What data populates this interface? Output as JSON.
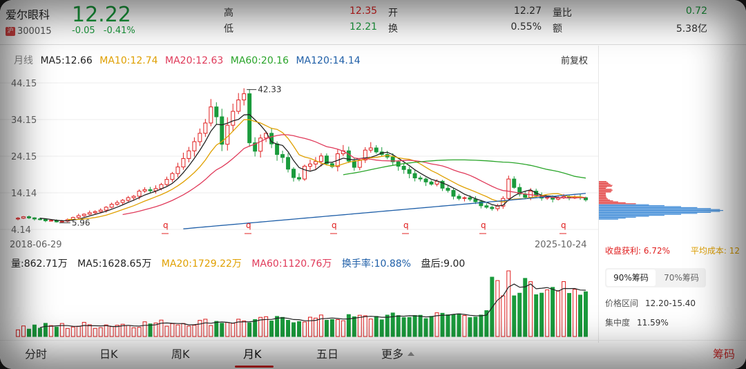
{
  "header": {
    "name": "爱尔眼科",
    "code": "300015",
    "price": "12.22",
    "change": "-0.05",
    "change_pct": "-0.41%",
    "stats": [
      {
        "key": "高",
        "value": "12.35",
        "color": "#e02020"
      },
      {
        "key": "低",
        "value": "12.21",
        "color": "#1a9b3c"
      },
      {
        "key": "开",
        "value": "12.27",
        "color": "#333333"
      },
      {
        "key": "换",
        "value": "0.55%",
        "color": "#333333"
      },
      {
        "key": "量比",
        "value": "0.72",
        "color": "#1a9b3c"
      },
      {
        "key": "额",
        "value": "5.38亿",
        "color": "#333333"
      }
    ]
  },
  "chart": {
    "period_label": "月线",
    "ma": [
      {
        "label": "MA5:12.66",
        "color": "#222222"
      },
      {
        "label": "MA10:12.74",
        "color": "#e0a000"
      },
      {
        "label": "MA20:12.63",
        "color": "#e03a5a"
      },
      {
        "label": "MA60:20.16",
        "color": "#2aa52a"
      },
      {
        "label": "MA120:14.14",
        "color": "#1f5fa8"
      }
    ],
    "adjust": "前复权",
    "y_ticks": [
      "44.15",
      "34.15",
      "24.15",
      "14.14",
      "4.14"
    ],
    "high_label": "42.33",
    "low_label": "5.96",
    "start_date": "2018-06-29",
    "end_date": "2025-10-24"
  },
  "volume": {
    "items": [
      {
        "label": "量:862.71万",
        "color": "#222222"
      },
      {
        "label": "MA5:1628.65万",
        "color": "#222222"
      },
      {
        "label": "MA20:1729.22万",
        "color": "#e0a000"
      },
      {
        "label": "MA60:1120.76万",
        "color": "#e03a5a"
      },
      {
        "label": "换手率:10.88%",
        "color": "#1f5fa8"
      },
      {
        "label": "盘后:9.00",
        "color": "#222222"
      }
    ]
  },
  "side": {
    "profit_label": "收盘获利:",
    "profit_value": "6.72%",
    "avg_label": "平均成本:",
    "avg_value": "12",
    "tab1": "90%筹码",
    "tab2": "70%筹码",
    "range_label": "价格区间",
    "range_value": "12.20-15.40",
    "conc_label": "集中度",
    "conc_value": "11.59%"
  },
  "tabs": [
    "分时",
    "日K",
    "周K",
    "月K",
    "五日",
    "更多"
  ],
  "chip_button": "筹码",
  "colors": {
    "up": "#e02020",
    "down": "#1a9b3c",
    "blue": "#1f5fa8"
  },
  "chart_data": {
    "type": "candlestick",
    "x_range": [
      "2018-06-29",
      "2025-10-24"
    ],
    "ylim": [
      4.14,
      44.15
    ],
    "closes": [
      7.2,
      7.6,
      7.3,
      7.0,
      6.9,
      6.5,
      6.6,
      6.2,
      6.4,
      6.8,
      7.4,
      7.9,
      8.3,
      8.7,
      9.0,
      9.4,
      10.2,
      11.0,
      11.5,
      12.1,
      12.8,
      13.2,
      14.6,
      15.0,
      14.7,
      15.3,
      16.4,
      17.8,
      19.4,
      21.2,
      23.5,
      25.6,
      28.1,
      30.4,
      33.2,
      37.6,
      34.9,
      27.4,
      32.6,
      36.4,
      39.5,
      41.2,
      27.8,
      25.5,
      29.1,
      30.4,
      27.5,
      24.6,
      23.8,
      20.6,
      18.3,
      17.9,
      21.4,
      22.0,
      22.7,
      24.2,
      22.1,
      21.3,
      24.8,
      25.6,
      22.8,
      21.1,
      23.1,
      25.8,
      26.4,
      25.3,
      24.6,
      23.9,
      22.6,
      21.4,
      20.5,
      19.4,
      18.2,
      17.9,
      17.1,
      16.5,
      17.3,
      15.4,
      14.8,
      13.2,
      12.6,
      12.8,
      12.4,
      11.7,
      10.6,
      10.2,
      9.8,
      10.5,
      12.6,
      17.9,
      15.6,
      13.8,
      12.9,
      14.6,
      13.4,
      12.7,
      12.9,
      12.4,
      12.8,
      13.1,
      12.7,
      13.0,
      12.8,
      12.22
    ]
  }
}
